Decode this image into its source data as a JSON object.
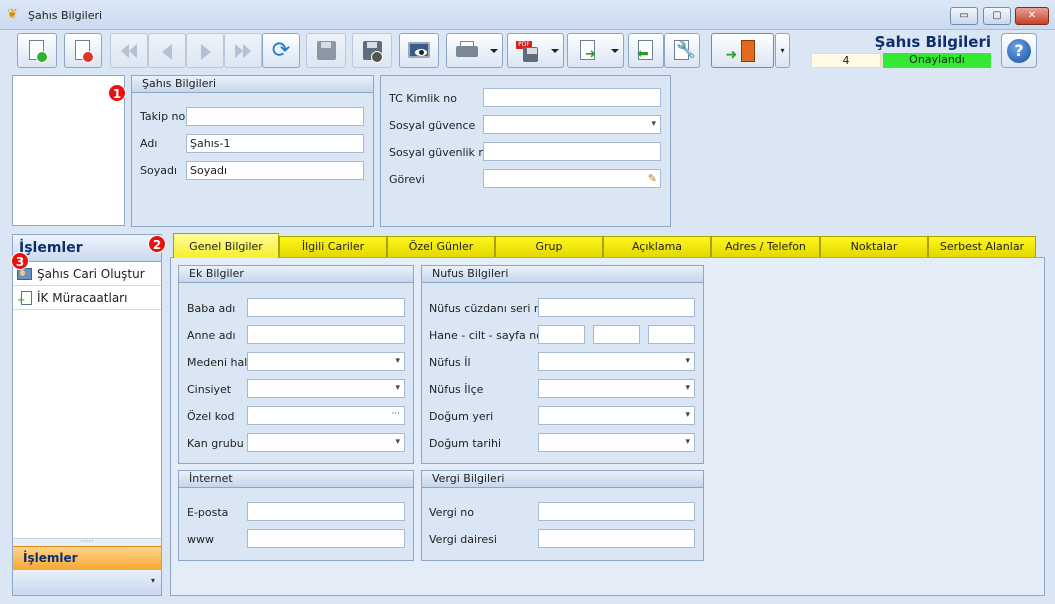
{
  "window": {
    "title": "Şahıs Bilgileri",
    "controls": {
      "minimize": "▭",
      "maximize": "▢",
      "close": "✕"
    }
  },
  "header": {
    "title": "Şahıs Bilgileri",
    "record_number": "4",
    "status": "Onaylandı",
    "status_color": "#34e834"
  },
  "toolbar": {
    "buttons": [
      {
        "name": "new-record",
        "icon": "document-add-icon"
      },
      {
        "name": "delete-record",
        "icon": "document-delete-icon"
      },
      {
        "name": "first-record",
        "icon": "first-icon"
      },
      {
        "name": "previous-record",
        "icon": "previous-icon"
      },
      {
        "name": "next-record",
        "icon": "next-icon"
      },
      {
        "name": "last-record",
        "icon": "last-icon"
      },
      {
        "name": "refresh",
        "icon": "refresh-icon"
      },
      {
        "name": "save",
        "icon": "save-icon"
      },
      {
        "name": "cancel",
        "icon": "cancel-save-icon"
      },
      {
        "name": "preview",
        "icon": "preview-icon"
      },
      {
        "name": "print",
        "icon": "printer-icon"
      },
      {
        "name": "export-pdf",
        "icon": "pdf-icon",
        "text": "PDF"
      },
      {
        "name": "transfer",
        "icon": "transfer-icon"
      },
      {
        "name": "back",
        "icon": "back-icon"
      },
      {
        "name": "tools",
        "icon": "wrench-icon"
      },
      {
        "name": "exit",
        "icon": "exit-door-icon"
      }
    ]
  },
  "callouts": [
    "1",
    "2",
    "3"
  ],
  "person": {
    "group_title": "Şahıs Bilgileri",
    "takip_no": {
      "label": "Takip no",
      "value": ""
    },
    "adi": {
      "label": "Adı",
      "value": "Şahıs-1"
    },
    "soyadi": {
      "label": "Soyadı",
      "value": "Soyadı"
    }
  },
  "identity": {
    "tc_kimlik": {
      "label": "TC Kimlik no",
      "value": ""
    },
    "sosyal_guvence": {
      "label": "Sosyal güvence",
      "value": ""
    },
    "sosyal_guvenlik_no": {
      "label": "Sosyal güvenlik no",
      "value": ""
    },
    "gorevi": {
      "label": "Görevi",
      "value": ""
    }
  },
  "operations": {
    "title": "İşlemler",
    "items": [
      {
        "label": "Şahıs Cari Oluştur",
        "icon": "person-card-icon"
      },
      {
        "label": "İK Müracaatları",
        "icon": "hr-list-icon"
      }
    ],
    "footer": "İşlemler",
    "grip": "·····",
    "expand": "▾"
  },
  "tabs": [
    {
      "label": "Genel Bilgiler",
      "active": true
    },
    {
      "label": "İlgili Cariler"
    },
    {
      "label": "Özel Günler"
    },
    {
      "label": "Grup"
    },
    {
      "label": "Açıklama"
    },
    {
      "label": "Adres / Telefon"
    },
    {
      "label": "Noktalar"
    },
    {
      "label": "Serbest Alanlar"
    }
  ],
  "ek_bilgiler": {
    "title": "Ek Bilgiler",
    "fields": [
      {
        "label": "Baba adı",
        "value": ""
      },
      {
        "label": "Anne adı",
        "value": ""
      },
      {
        "label": "Medeni hali",
        "value": ""
      },
      {
        "label": "Cinsiyet",
        "value": ""
      },
      {
        "label": "Özel kod",
        "value": ""
      },
      {
        "label": "Kan grubu",
        "value": ""
      }
    ]
  },
  "nufus_bilgileri": {
    "title": "Nufus Bilgileri",
    "fields": [
      {
        "label": "Nüfus cüzdanı seri no",
        "value": ""
      },
      {
        "label": "Hane - cilt - sayfa no",
        "value": ""
      },
      {
        "label": "Nüfus İl",
        "value": ""
      },
      {
        "label": "Nüfus İlçe",
        "value": ""
      },
      {
        "label": "Doğum yeri",
        "value": ""
      },
      {
        "label": "Doğum tarihi",
        "value": ""
      }
    ]
  },
  "internet": {
    "title": "İnternet",
    "fields": [
      {
        "label": "E-posta",
        "value": ""
      },
      {
        "label": "www",
        "value": ""
      }
    ]
  },
  "vergi_bilgileri": {
    "title": "Vergi Bilgileri",
    "fields": [
      {
        "label": "Vergi no",
        "value": ""
      },
      {
        "label": "Vergi dairesi",
        "value": ""
      }
    ]
  },
  "colors": {
    "accent_blue": "#0e2f6e",
    "tab_yellow": "#fff71a",
    "callout_red": "#e8110f",
    "footer_orange": "#f6a733"
  }
}
